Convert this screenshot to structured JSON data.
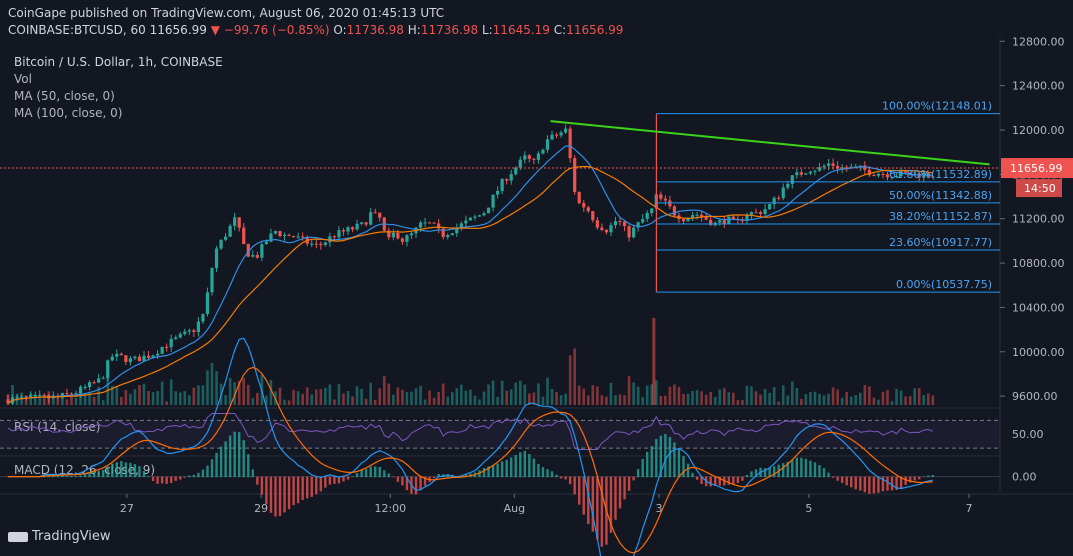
{
  "header": {
    "publisher_line": "CoinGape published on TradingView.com, August 06, 2020 01:45:13 UTC",
    "symbol": "COINBASE:BTCUSD, 60",
    "last": "11656.99",
    "change": "−99.76 (−0.85%)",
    "open": "11736.98",
    "high": "11736.98",
    "low": "11645.19",
    "close": "11656.99"
  },
  "legend": {
    "title": "Bitcoin / U.S. Dollar, 1h, COINBASE",
    "vol": "Vol",
    "ma50": "MA (50, close, 0)",
    "ma100": "MA (100, close, 0)"
  },
  "rsi_label": "RSI (14, close)",
  "macd_label": "MACD (12, 26, close, 9)",
  "footer": {
    "brand": "TradingView"
  },
  "colors": {
    "bg": "#131722",
    "up": "#26a69a",
    "down": "#ef5350",
    "ma50": "#2f8de4",
    "ma100": "#f57c00",
    "trend": "#3bd41b",
    "fib": "#2196f3",
    "rsi": "#7e57c2"
  },
  "chart_data": [
    {
      "type": "line",
      "title": "Bitcoin / U.S. Dollar, 1h, COINBASE",
      "price_ticks": [
        "12800.00",
        "12400.00",
        "12000.00",
        "11600.00",
        "11200.00",
        "10800.00",
        "10400.00",
        "10000.00",
        "9600.00"
      ],
      "price_tick_values": [
        12800,
        12400,
        12000,
        11600,
        11200,
        10800,
        10400,
        10000,
        9600
      ],
      "ylim": [
        9520,
        12830
      ],
      "x_ticks": [
        "27",
        "29",
        "12:00",
        "Aug",
        "3",
        "5",
        "7"
      ],
      "current_price_label": "11656.99",
      "countdown_label": "14:50",
      "approx_close_path": {
        "x_days": [
          0,
          0.5,
          1,
          1.2,
          1.4,
          1.6,
          1.8,
          2.0,
          2.2,
          2.4,
          2.6,
          2.8,
          3.0,
          3.2,
          3.4,
          3.6,
          3.8,
          4.0,
          4.2,
          4.4,
          4.6,
          4.8,
          5.0,
          5.2,
          5.3,
          5.5,
          5.7,
          6.0,
          6.3,
          6.6,
          6.9,
          7.0,
          7.2,
          7.3,
          7.4,
          7.45,
          7.5,
          7.6,
          7.8,
          8.0,
          8.2,
          8.4,
          8.6,
          8.8,
          9.0,
          9.2,
          9.4,
          9.6,
          9.8,
          10.0,
          10.2,
          10.4,
          10.6,
          10.8,
          11.0,
          11.2,
          11.4,
          11.6,
          11.8,
          12.0,
          12.2,
          12.4,
          12.5,
          12.55,
          12.7,
          12.9,
          13.1,
          13.3,
          13.5,
          13.7,
          13.9,
          14.1,
          14.3,
          14.5,
          14.7,
          14.9,
          15.1,
          15.3,
          15.5,
          15.7,
          15.9,
          16.1,
          16.3,
          16.5,
          16.7,
          16.9,
          17.1,
          17.3,
          17.5,
          17.7,
          17.9,
          18.1,
          18.2
        ],
        "price": [
          9570,
          9580,
          9590,
          9620,
          9650,
          9700,
          9750,
          9960,
          9950,
          9920,
          9950,
          9980,
          10050,
          10100,
          10150,
          10200,
          10350,
          10900,
          11050,
          11200,
          10900,
          10850,
          11000,
          11100,
          11050,
          11050,
          11000,
          10950,
          11050,
          11100,
          11150,
          11250,
          11200,
          11050,
          10980,
          11050,
          11100,
          11000,
          11050,
          11150,
          11150,
          11050,
          11100,
          11150,
          11200,
          11250,
          11400,
          11550,
          11650,
          11750,
          11700,
          11900,
          11950,
          12000,
          11350,
          11300,
          11150,
          11100,
          11200,
          11050,
          11150,
          11250,
          11300,
          11400,
          11350,
          11250,
          11200,
          11250,
          11200,
          11150,
          11200,
          11150,
          11250,
          11250,
          11300,
          11400,
          11550,
          11600,
          11650,
          11650,
          11700,
          11660,
          11657,
          11650,
          11620,
          11610,
          11600,
          11600,
          11600,
          11600,
          11600,
          11600,
          11600
        ]
      },
      "series": [
        {
          "name": "MA (50, close, 0)"
        },
        {
          "name": "MA (100, close, 0)"
        }
      ],
      "trendline": {
        "from": {
          "x_day": 10.5,
          "price": 12080
        },
        "to": {
          "x_day": 19.0,
          "price": 11690
        }
      },
      "fibonacci": [
        {
          "label": "100.00%(12148.01)",
          "level": 12148.01
        },
        {
          "label": "61.80%(11532.89)",
          "level": 11532.89
        },
        {
          "label": "50.00%(11342.88)",
          "level": 11342.88
        },
        {
          "label": "38.20%(11152.87)",
          "level": 11152.87
        },
        {
          "label": "23.60%(10917.77)",
          "level": 10917.77
        },
        {
          "label": "0.00%(10537.75)",
          "level": 10537.75
        }
      ]
    },
    {
      "type": "line",
      "title": "RSI (14, close)",
      "ticks": [
        "50.00"
      ],
      "tick_values": [
        50
      ],
      "ylim": [
        20,
        85
      ]
    },
    {
      "type": "line",
      "title": "MACD (12, 26, close, 9)",
      "ticks": [
        "0.00"
      ],
      "tick_values": [
        0
      ],
      "ylim": [
        -140,
        170
      ]
    }
  ]
}
